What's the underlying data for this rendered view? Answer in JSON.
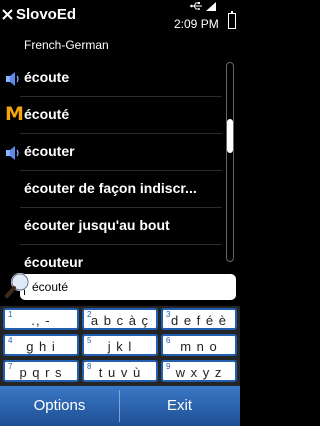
{
  "app": {
    "title": "SlovoEd",
    "close_icon": "close-icon"
  },
  "status": {
    "time": "2:09 PM",
    "usb_icon": "usb-icon",
    "signal_icon": "signal-icon",
    "battery_icon": "battery-icon"
  },
  "dictionary": {
    "language_pair": "French-German"
  },
  "list": {
    "items": [
      {
        "label": "écoute",
        "icon": "speaker-icon"
      },
      {
        "label": "écouté",
        "icon": "m-icon",
        "icon_text": "M"
      },
      {
        "label": "écouter",
        "icon": "speaker-icon"
      },
      {
        "label": "écouter de façon indiscr...",
        "icon": ""
      },
      {
        "label": "écouter jusqu'au bout",
        "icon": ""
      },
      {
        "label": "écouteur",
        "icon": ""
      }
    ]
  },
  "search": {
    "value": "écouté",
    "icon": "search-icon"
  },
  "keypad": {
    "keys": [
      {
        "num": "1",
        "label": "., -"
      },
      {
        "num": "2",
        "label": "a b c à ç"
      },
      {
        "num": "3",
        "label": "d e f é è"
      },
      {
        "num": "4",
        "label": "g h i"
      },
      {
        "num": "5",
        "label": "j k l"
      },
      {
        "num": "6",
        "label": "m n o"
      },
      {
        "num": "7",
        "label": "p q r s"
      },
      {
        "num": "8",
        "label": "t u v ù"
      },
      {
        "num": "9",
        "label": "w x y z"
      }
    ]
  },
  "softkeys": {
    "left": "Options",
    "right": "Exit"
  },
  "colors": {
    "accent": "#235fb0",
    "softkey_bar": "#2f66b0",
    "m_icon": "#f2a40a"
  }
}
